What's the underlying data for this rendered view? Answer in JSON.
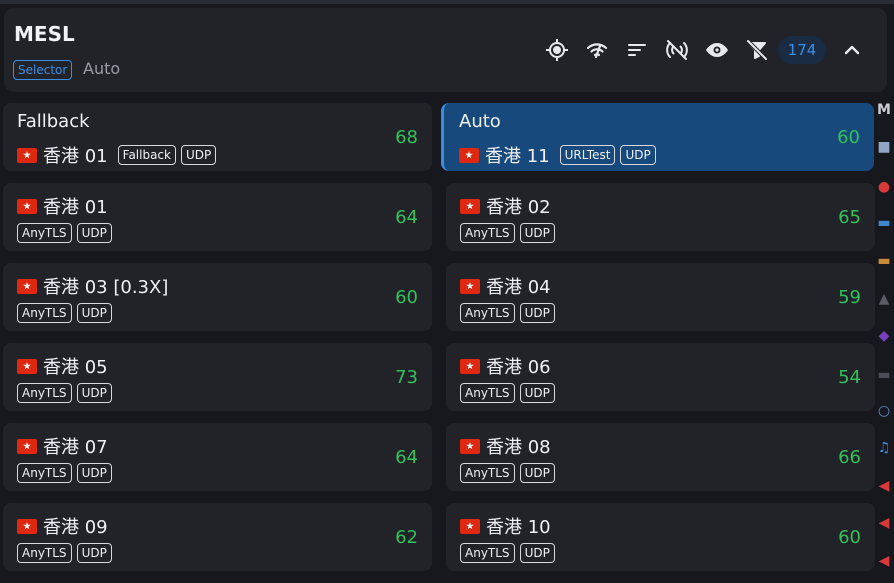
{
  "group": {
    "title": "MESL",
    "type": "Selector",
    "current": "Auto",
    "count": "174"
  },
  "header_icons": [
    {
      "name": "locate-icon"
    },
    {
      "name": "speed-test-icon"
    },
    {
      "name": "sort-icon"
    },
    {
      "name": "signal-off-icon"
    },
    {
      "name": "eye-icon"
    },
    {
      "name": "filter-off-icon"
    }
  ],
  "cards": [
    {
      "name": "Fallback",
      "sub_node": "香港 01",
      "tags": [
        "Fallback",
        "UDP"
      ],
      "latency": "68",
      "active": false,
      "kind": "group"
    },
    {
      "name": "Auto",
      "sub_node": "香港 11",
      "tags": [
        "URLTest",
        "UDP"
      ],
      "latency": "60",
      "active": true,
      "kind": "group"
    },
    {
      "name": "香港 01",
      "tags": [
        "AnyTLS",
        "UDP"
      ],
      "latency": "64",
      "kind": "node"
    },
    {
      "name": "香港 02",
      "tags": [
        "AnyTLS",
        "UDP"
      ],
      "latency": "65",
      "kind": "node"
    },
    {
      "name": "香港 03 [0.3X]",
      "tags": [
        "AnyTLS",
        "UDP"
      ],
      "latency": "60",
      "kind": "node"
    },
    {
      "name": "香港 04",
      "tags": [
        "AnyTLS",
        "UDP"
      ],
      "latency": "59",
      "kind": "node"
    },
    {
      "name": "香港 05",
      "tags": [
        "AnyTLS",
        "UDP"
      ],
      "latency": "73",
      "kind": "node"
    },
    {
      "name": "香港 06",
      "tags": [
        "AnyTLS",
        "UDP"
      ],
      "latency": "54",
      "kind": "node"
    },
    {
      "name": "香港 07",
      "tags": [
        "AnyTLS",
        "UDP"
      ],
      "latency": "64",
      "kind": "node"
    },
    {
      "name": "香港 08",
      "tags": [
        "AnyTLS",
        "UDP"
      ],
      "latency": "66",
      "kind": "node"
    },
    {
      "name": "香港 09",
      "tags": [
        "AnyTLS",
        "UDP"
      ],
      "latency": "62",
      "kind": "node"
    },
    {
      "name": "香港 10",
      "tags": [
        "AnyTLS",
        "UDP"
      ],
      "latency": "60",
      "kind": "node"
    }
  ],
  "colors": {
    "background": "#17181d",
    "card": "#222329",
    "active_card": "#17497d",
    "accent": "#3a8ee6",
    "latency_good": "#32c15a"
  },
  "rail_icons": [
    "letter-m-icon",
    "robot-icon",
    "apple-icon",
    "monitor-icon",
    "wallet-icon",
    "game-icon",
    "devil-icon",
    "controller-icon",
    "magnifier-icon",
    "music-icon",
    "megaphone-icon",
    "megaphone-icon",
    "megaphone-icon"
  ]
}
